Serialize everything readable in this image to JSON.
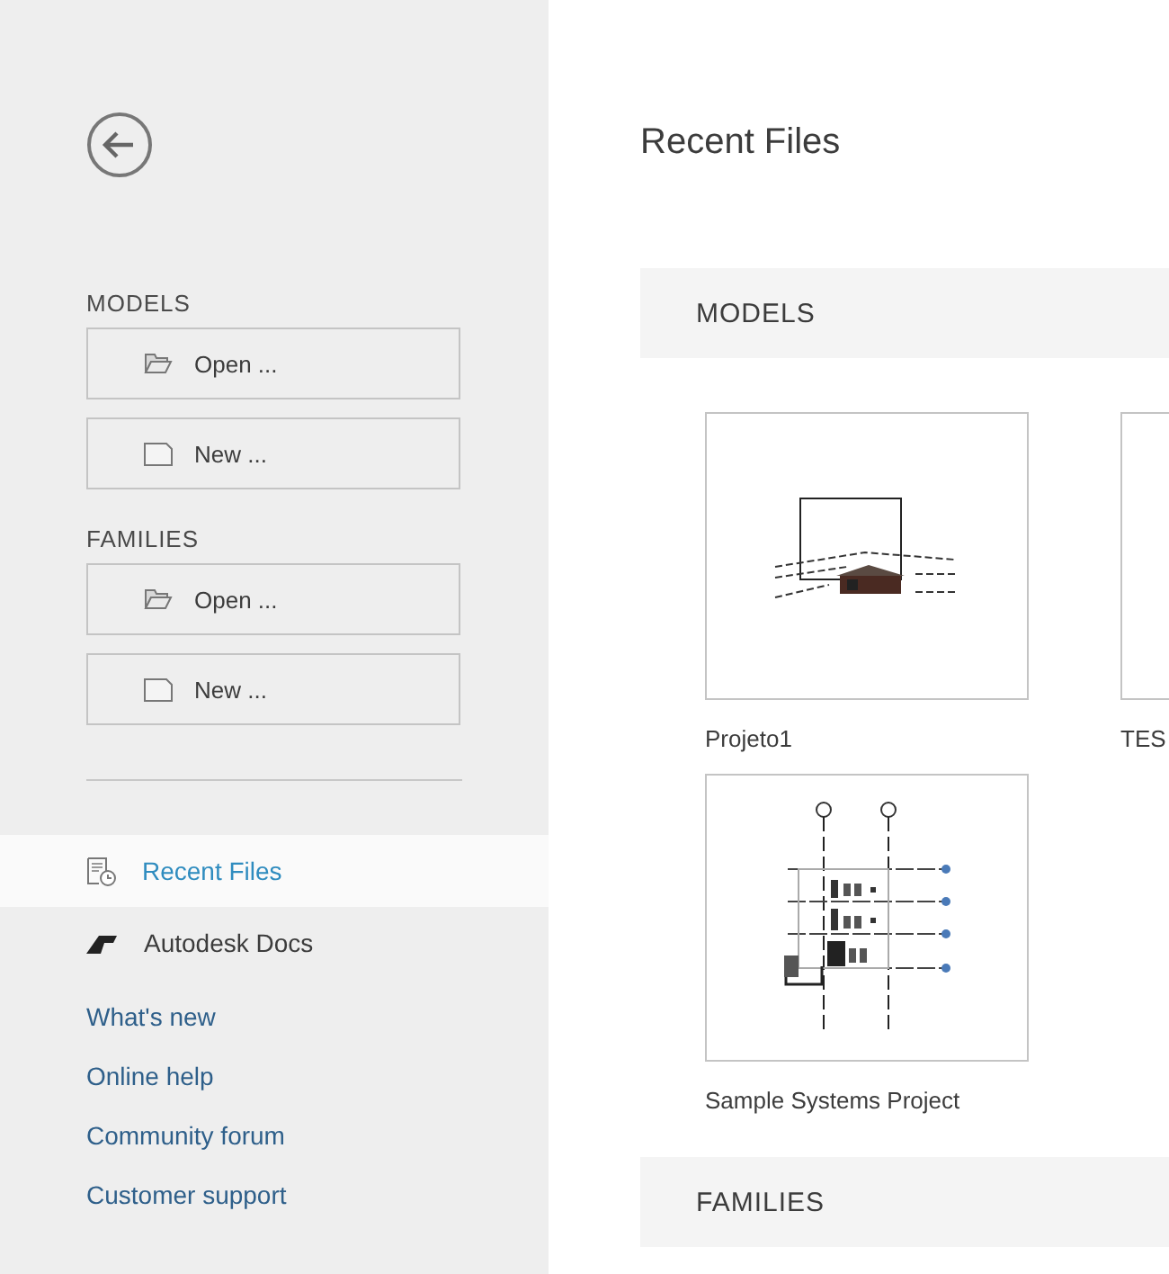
{
  "sidebar": {
    "sections": [
      {
        "title": "MODELS",
        "buttons": [
          {
            "kind": "open",
            "label": "Open ..."
          },
          {
            "kind": "new",
            "label": "New ..."
          }
        ]
      },
      {
        "title": "FAMILIES",
        "buttons": [
          {
            "kind": "open",
            "label": "Open ..."
          },
          {
            "kind": "new",
            "label": "New ..."
          }
        ]
      }
    ],
    "nav": [
      {
        "kind": "recent",
        "label": "Recent Files",
        "selected": true
      },
      {
        "kind": "docs",
        "label": "Autodesk Docs",
        "selected": false
      }
    ],
    "links": [
      "What's new",
      "Online help",
      "Community forum",
      "Customer support"
    ]
  },
  "main": {
    "title": "Recent Files",
    "sections": [
      {
        "title": "MODELS",
        "files": [
          {
            "kind": "house",
            "name": "Projeto1"
          },
          {
            "kind": "blank",
            "name": "TES"
          },
          {
            "kind": "systems",
            "name": "Sample Systems Project"
          }
        ]
      },
      {
        "title": "FAMILIES"
      }
    ]
  }
}
